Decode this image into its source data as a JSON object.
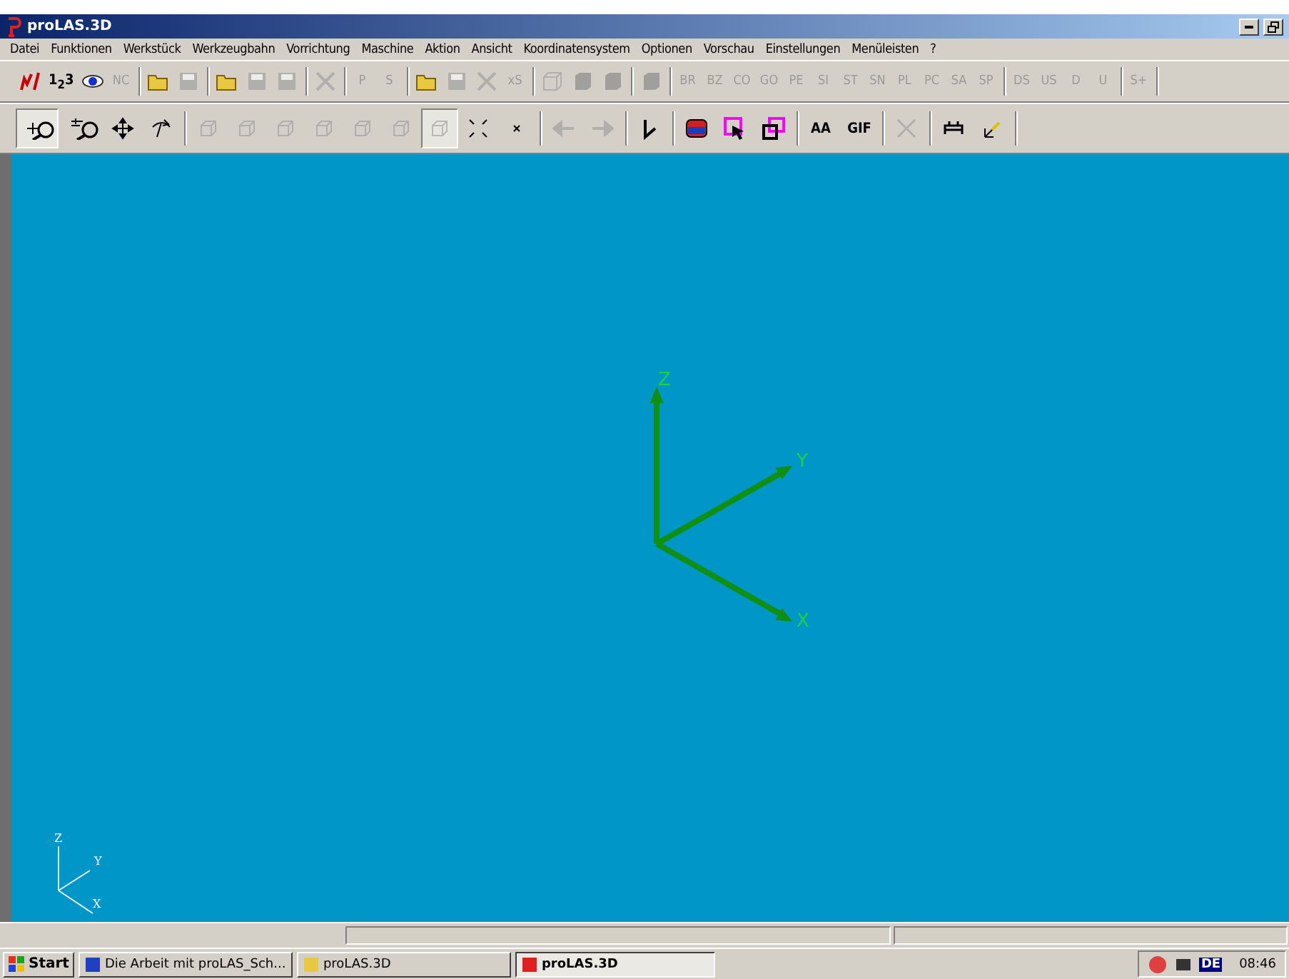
{
  "window": {
    "title": "proLAS.3D"
  },
  "menu": [
    "Datei",
    "Funktionen",
    "Werkstück",
    "Werkzeugbahn",
    "Vorrichtung",
    "Maschine",
    "Aktion",
    "Ansicht",
    "Koordinatensystem",
    "Optionen",
    "Vorschau",
    "Einstellungen",
    "Menüleisten",
    "?"
  ],
  "toolbar_1": [
    [
      {
        "kind": "icon",
        "disabled": false
      },
      {
        "kind": "text",
        "label": "1$_{2}$3",
        "disabled": false
      },
      {
        "kind": "icon",
        "disabled": false
      },
      {
        "kind": "text",
        "label": "NC",
        "disabled": true
      }
    ],
    [
      {
        "kind": "icon",
        "disabled": false
      },
      {
        "kind": "icon",
        "disabled": true
      }
    ],
    [
      {
        "kind": "icon",
        "disabled": false
      },
      {
        "kind": "icon",
        "disabled": true
      },
      {
        "kind": "icon",
        "disabled": true
      }
    ],
    [
      {
        "kind": "icon",
        "disabled": true
      }
    ],
    [
      {
        "kind": "text",
        "label": "P",
        "disabled": true
      },
      {
        "kind": "text",
        "label": "S",
        "disabled": true
      }
    ],
    [
      {
        "kind": "icon",
        "disabled": false
      },
      {
        "kind": "icon",
        "disabled": true
      },
      {
        "kind": "icon",
        "disabled": true
      },
      {
        "kind": "text",
        "label": "xS",
        "disabled": true
      }
    ],
    [
      {
        "kind": "icon",
        "disabled": true
      },
      {
        "kind": "icon",
        "disabled": true
      },
      {
        "kind": "icon",
        "disabled": true
      }
    ],
    [
      {
        "kind": "icon",
        "disabled": true
      }
    ],
    [
      {
        "kind": "text",
        "label": "BR",
        "disabled": true
      },
      {
        "kind": "text",
        "label": "BZ",
        "disabled": true
      },
      {
        "kind": "text",
        "label": "CO",
        "disabled": true
      },
      {
        "kind": "text",
        "label": "GO",
        "disabled": true
      },
      {
        "kind": "text",
        "label": "PE",
        "disabled": true
      },
      {
        "kind": "text",
        "label": "SI",
        "disabled": true
      },
      {
        "kind": "text",
        "label": "ST",
        "disabled": true
      },
      {
        "kind": "text",
        "label": "SN",
        "disabled": true
      },
      {
        "kind": "text",
        "label": "PL",
        "disabled": true
      },
      {
        "kind": "text",
        "label": "PC",
        "disabled": true
      },
      {
        "kind": "text",
        "label": "SA",
        "disabled": true
      },
      {
        "kind": "text",
        "label": "SP",
        "disabled": true
      }
    ],
    [
      {
        "kind": "text",
        "label": "DS",
        "disabled": true
      },
      {
        "kind": "text",
        "label": "US",
        "disabled": true
      },
      {
        "kind": "text",
        "label": "D",
        "disabled": true
      },
      {
        "kind": "text",
        "label": "U",
        "disabled": true
      }
    ],
    [
      {
        "kind": "text",
        "label": "S+",
        "disabled": true
      }
    ]
  ],
  "toolbar_2": [
    [
      {
        "kind": "icon",
        "disabled": false,
        "selected": true
      },
      {
        "kind": "icon",
        "disabled": false,
        "selected": false
      },
      {
        "kind": "icon",
        "disabled": false,
        "selected": false
      },
      {
        "kind": "icon",
        "disabled": false,
        "selected": false
      }
    ],
    [
      {
        "kind": "icon",
        "disabled": true,
        "selected": false
      },
      {
        "kind": "icon",
        "disabled": true,
        "selected": false
      },
      {
        "kind": "icon",
        "disabled": true,
        "selected": false
      },
      {
        "kind": "icon",
        "disabled": true,
        "selected": false
      },
      {
        "kind": "icon",
        "disabled": true,
        "selected": false
      },
      {
        "kind": "icon",
        "disabled": true,
        "selected": false
      },
      {
        "kind": "icon",
        "disabled": true,
        "selected": true
      },
      {
        "kind": "icon",
        "disabled": false,
        "selected": false
      },
      {
        "kind": "icon",
        "disabled": false,
        "selected": false
      }
    ],
    [
      {
        "kind": "icon",
        "disabled": true,
        "selected": false
      },
      {
        "kind": "icon",
        "disabled": true,
        "selected": false
      }
    ],
    [
      {
        "kind": "icon",
        "disabled": false,
        "selected": false
      }
    ],
    [
      {
        "kind": "icon",
        "disabled": false,
        "selected": false
      },
      {
        "kind": "icon",
        "disabled": false,
        "selected": false
      },
      {
        "kind": "icon",
        "disabled": false,
        "selected": false
      }
    ],
    [
      {
        "kind": "text",
        "label": "AA",
        "disabled": false,
        "selected": false
      },
      {
        "kind": "text",
        "label": "GIF",
        "disabled": false,
        "selected": false
      }
    ],
    [
      {
        "kind": "icon",
        "disabled": true,
        "selected": false
      }
    ],
    [
      {
        "kind": "icon",
        "disabled": false,
        "selected": false
      },
      {
        "kind": "icon",
        "disabled": false,
        "selected": false
      }
    ]
  ],
  "viewport": {
    "axis_labels": [
      "Z",
      "Y",
      "X"
    ],
    "mini_axis_labels": [
      "Z",
      "Y",
      "X"
    ]
  },
  "taskbar": {
    "start": "Start",
    "tasks": [
      {
        "label": "Die Arbeit mit proLAS_Sch...",
        "selected": false
      },
      {
        "label": "proLAS.3D",
        "selected": false
      },
      {
        "label": "proLAS.3D",
        "selected": true
      }
    ],
    "language": "DE",
    "clock": "08:46"
  }
}
